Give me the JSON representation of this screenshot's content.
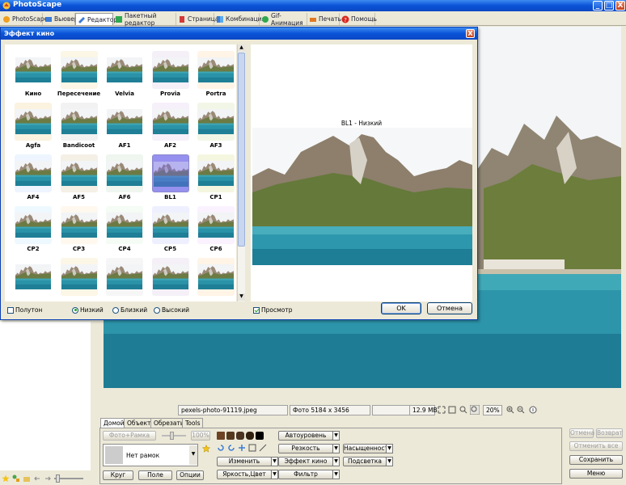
{
  "app": {
    "title": "PhotoScape",
    "icon": "photoscape-logo-icon"
  },
  "window_controls": {
    "minimize": "_",
    "maximize": "□",
    "close": "X"
  },
  "tabs": [
    {
      "label": "PhotoScape",
      "icon": "photoscape-icon"
    },
    {
      "label": "Вьювер",
      "icon": "viewer-icon"
    },
    {
      "label": "Редактор",
      "icon": "editor-icon",
      "active": true
    },
    {
      "label": "Пакетный редактор",
      "icon": "batch-editor-icon"
    },
    {
      "label": "Страница",
      "icon": "page-icon"
    },
    {
      "label": "Комбинация",
      "icon": "combine-icon"
    },
    {
      "label": "Gif-Анимация",
      "icon": "gif-icon"
    },
    {
      "label": "Печать",
      "icon": "print-icon"
    },
    {
      "label": "Помощь",
      "icon": "help-icon"
    }
  ],
  "dialog": {
    "title": "Эффект кино",
    "close": "X",
    "effects": [
      "Кино",
      "Пересечение",
      "Velvia",
      "Provia",
      "Portra",
      "Agfa",
      "Bandicoot",
      "AF1",
      "AF2",
      "AF3",
      "AF4",
      "AF5",
      "AF6",
      "BL1",
      "CP1",
      "CP2",
      "CP3",
      "CP4",
      "CP5",
      "CP6",
      "",
      "",
      "",
      "",
      ""
    ],
    "selected": "BL1",
    "preview_label": "BL1 - Низкий",
    "halftone_label": "Полутон",
    "radio_low": "Низкий",
    "radio_close": "Близкий",
    "radio_high": "Высокий",
    "preview_check_label": "Просмотр",
    "ok": "OK",
    "cancel": "Отмена"
  },
  "status": {
    "filename": "pexels-photo-91119.jpeg",
    "dims": "Фото 5184 x 3456",
    "size": "12.9 MB",
    "zoom": "20%"
  },
  "bottom_tabs": [
    "Домой",
    "Объект",
    "Обрезать",
    "Tools"
  ],
  "bottom": {
    "photo_frame": "Фото+Рамка",
    "percent": "100%",
    "frame_select": "Нет рамок",
    "krug": "Круг",
    "pole": "Поле",
    "options": "Опции",
    "autolevel": "Автоуровень",
    "sharpness": "Резкость",
    "saturation": "Насыщенность",
    "change": "Изменить",
    "film_effect": "Эффект кино",
    "backlight": "Подсветка",
    "brightness": "Яркость,Цвет",
    "filter": "Фильтр"
  },
  "right_buttons": {
    "undo": "Отмена",
    "redo": "Возврат",
    "undo_all": "Отменить все",
    "save": "Сохранить",
    "menu": "Меню"
  }
}
